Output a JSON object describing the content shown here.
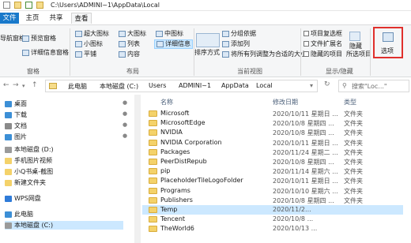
{
  "window": {
    "title": "C:\\Users\\ADMINI~1\\AppData\\Local"
  },
  "tabs": [
    {
      "label": "文件"
    },
    {
      "label": "主页"
    },
    {
      "label": "共享"
    },
    {
      "label": "查看"
    }
  ],
  "ribbon": {
    "pane_group": {
      "nav_pane": "导航窗格",
      "preview": "预览窗格",
      "details": "详细信息窗格",
      "label": "窗格"
    },
    "layout_group": {
      "items": [
        "超大图标",
        "大图标",
        "中图标",
        "小图标",
        "列表",
        "详细信息",
        "平铺",
        "内容"
      ],
      "label": "布局"
    },
    "view_group": {
      "sort": "排序方式",
      "group_by": "分组依据",
      "add_col": "添加列",
      "fit_cols": "将所有列调整为合适的大小",
      "label": "当前视图"
    },
    "show_group": {
      "item_check": "项目复选框",
      "ext": "文件扩展名",
      "hidden": "隐藏的项目",
      "hide_sel": "隐藏",
      "hide_sel2": "所选项目",
      "label": "显示/隐藏"
    },
    "options": "选项"
  },
  "address": {
    "crumbs": [
      "此电脑",
      "本地磁盘 (C:)",
      "Users",
      "ADMINI~1",
      "AppData",
      "Local"
    ],
    "search_placeholder": "搜索\"Loc...\""
  },
  "nav": {
    "items": [
      {
        "label": "桌面",
        "color": "#3c8fd6"
      },
      {
        "label": "下载",
        "color": "#3c8fd6"
      },
      {
        "label": "文档",
        "color": "#8a8a8a"
      },
      {
        "label": "图片",
        "color": "#3c8fd6"
      },
      {
        "label": "本地磁盘 (D:)",
        "color": "#9a9a9a"
      },
      {
        "label": "手机图片视频",
        "color": "#f4d26a"
      },
      {
        "label": "小Q书桌-截图",
        "color": "#f4d26a"
      },
      {
        "label": "新建文件夹",
        "color": "#f4d26a"
      },
      {
        "label": "WPS网盘",
        "color": "#2f7bd8"
      },
      {
        "label": "此电脑",
        "color": "#3c8fd6"
      },
      {
        "label": "本地磁盘 (C:)",
        "color": "#9a9a9a"
      }
    ]
  },
  "list": {
    "headers": {
      "name": "名称",
      "date": "修改日期",
      "type": "类型"
    },
    "rows": [
      {
        "name": "Microsoft",
        "date": "2020/10/11 星期日 ...",
        "type": "文件夹"
      },
      {
        "name": "MicrosoftEdge",
        "date": "2020/10/8 星期四 ...",
        "type": "文件夹"
      },
      {
        "name": "NVIDIA",
        "date": "2020/10/8 星期四 ...",
        "type": "文件夹"
      },
      {
        "name": "NVIDIA Corporation",
        "date": "2020/10/11 星期日 ...",
        "type": "文件夹"
      },
      {
        "name": "Packages",
        "date": "2020/11/24 星期二 ...",
        "type": "文件夹"
      },
      {
        "name": "PeerDistRepub",
        "date": "2020/10/8 星期四 ...",
        "type": "文件夹"
      },
      {
        "name": "pip",
        "date": "2020/11/14 星期六 ...",
        "type": "文件夹"
      },
      {
        "name": "PlaceholderTileLogoFolder",
        "date": "2020/10/11 星期日 ...",
        "type": "文件夹"
      },
      {
        "name": "Programs",
        "date": "2020/10/10 星期六 ...",
        "type": "文件夹"
      },
      {
        "name": "Publishers",
        "date": "2020/10/8 星期四 ...",
        "type": "文件夹"
      },
      {
        "name": "Temp",
        "date": "2020/11/2...",
        "type": ""
      },
      {
        "name": "Tencent",
        "date": "2020/10/8 ...",
        "type": ""
      },
      {
        "name": "TheWorld6",
        "date": "2020/10/13 ...",
        "type": ""
      }
    ]
  }
}
